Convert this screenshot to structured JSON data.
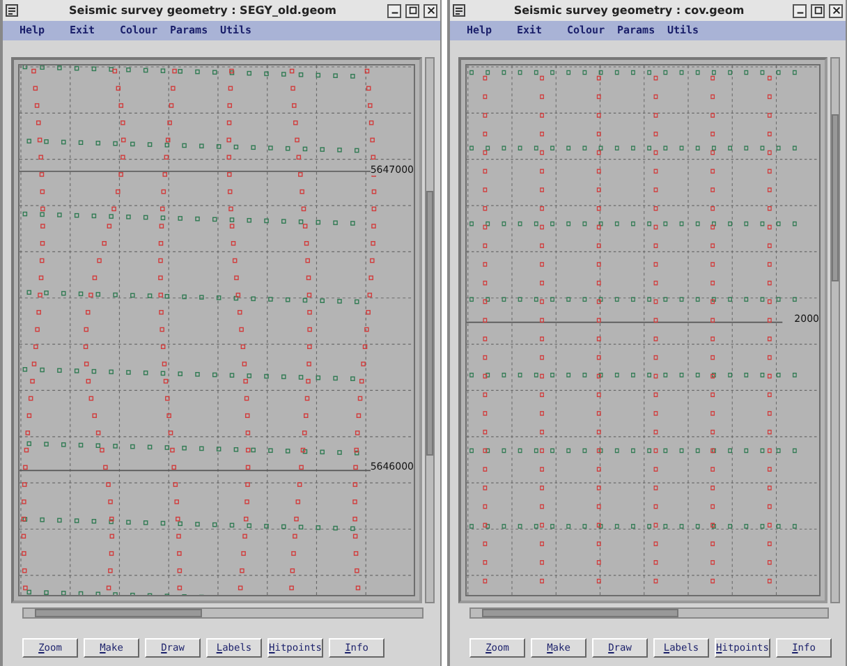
{
  "windows": [
    {
      "title": "Seismic survey geometry : SEGY_old.geom",
      "menu": [
        "Help",
        "Exit",
        "Colour",
        "Params",
        "Utils"
      ],
      "kind": "irregular",
      "axis_labels": [
        "5647000",
        "5646000"
      ],
      "buttons": [
        "Zoom",
        "Make",
        "Draw",
        "Labels",
        "Hitpoints",
        "Info"
      ]
    },
    {
      "title": "Seismic survey geometry : cov.geom",
      "menu": [
        "Help",
        "Exit",
        "Colour",
        "Params",
        "Utils"
      ],
      "kind": "regular",
      "axis_labels": [
        "2000"
      ],
      "buttons": [
        "Zoom",
        "Make",
        "Draw",
        "Labels",
        "Hitpoints",
        "Info"
      ]
    }
  ]
}
